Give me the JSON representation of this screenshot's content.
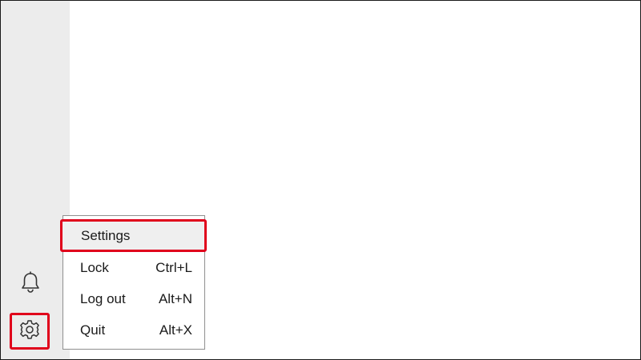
{
  "sidebar": {
    "notifications_icon": "bell-icon",
    "settings_icon": "gear-icon"
  },
  "menu": {
    "items": [
      {
        "label": "Settings",
        "shortcut": ""
      },
      {
        "label": "Lock",
        "shortcut": "Ctrl+L"
      },
      {
        "label": "Log out",
        "shortcut": "Alt+N"
      },
      {
        "label": "Quit",
        "shortcut": "Alt+X"
      }
    ]
  },
  "colors": {
    "highlight": "#e0001b",
    "sidebar_bg": "#ececec",
    "hover_bg": "#efefef"
  }
}
